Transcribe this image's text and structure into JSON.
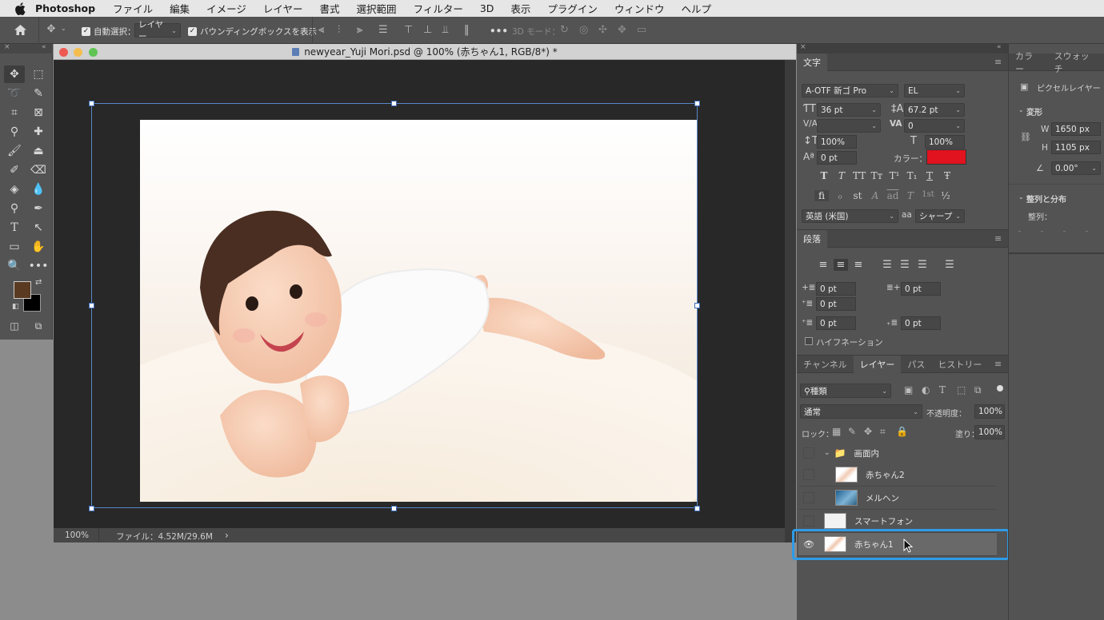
{
  "menubar": {
    "app_name": "Photoshop",
    "items": [
      "ファイル",
      "編集",
      "イメージ",
      "レイヤー",
      "書式",
      "選択範囲",
      "フィルター",
      "3D",
      "表示",
      "プラグイン",
      "ウィンドウ",
      "ヘルプ"
    ]
  },
  "options_bar": {
    "auto_select_label": "自動選択：",
    "auto_select_target": "レイヤー",
    "bounding_box_label": "バウンディングボックスを表示",
    "mode_3d_label": "3D モード：",
    "more": "•••"
  },
  "document": {
    "title": "newyear_Yuji Mori.psd @ 100% (赤ちゃん1, RGB/8*) *",
    "zoom": "100%",
    "file_info": "ファイル：4.52M/29.6M",
    "status_arrow": "›"
  },
  "character_panel": {
    "tab": "文字",
    "font_family": "A-OTF 新ゴ Pro",
    "font_style": "EL",
    "font_size": "36 pt",
    "leading": "67.2 pt",
    "kerning": "",
    "tracking": "0",
    "vertical_scale": "100%",
    "horizontal_scale": "100%",
    "baseline_shift": "0 pt",
    "color_label": "カラー：",
    "color_value": "#e0131f",
    "language": "英語 (米国)",
    "antialias_label": "aa",
    "antialias": "シャープ",
    "style_buttons": [
      "T",
      "T",
      "TT",
      "Tт",
      "T¹",
      "T₁",
      "T",
      "Ŧ"
    ],
    "opentype_buttons": [
      "ﬁ",
      "ℴ",
      "st",
      "A",
      "ad",
      "T",
      "1st",
      "½"
    ]
  },
  "paragraph_panel": {
    "tab": "段落",
    "indent_left": "0 pt",
    "indent_right": "0 pt",
    "indent_first": "0 pt",
    "space_before": "0 pt",
    "space_after": "0 pt",
    "hyphenation_label": "ハイフネーション"
  },
  "properties_panel": {
    "tabs": [
      "カラー",
      "スウォッチ"
    ],
    "layer_type": "ピクセルレイヤー",
    "transform_label": "変形",
    "w_label": "W",
    "w_value": "1650 px",
    "h_label": "H",
    "h_value": "1105 px",
    "angle_value": "0.00°",
    "align_label": "整列と分布",
    "align_sub": "整列："
  },
  "layers_panel": {
    "tabs": [
      "チャンネル",
      "レイヤー",
      "パス",
      "ヒストリー"
    ],
    "active_tab": "レイヤー",
    "filter_label": "種類",
    "blend_mode": "通常",
    "opacity_label": "不透明度：",
    "opacity": "100%",
    "lock_label": "ロック：",
    "fill_label": "塗り：",
    "fill": "100%",
    "layers": [
      {
        "name": "画面内",
        "type": "group",
        "visible": false
      },
      {
        "name": "赤ちゃん2",
        "type": "pixel",
        "visible": false
      },
      {
        "name": "メルヘン",
        "type": "pixel",
        "visible": false
      },
      {
        "name": "スマートフォン",
        "type": "pixel",
        "visible": false
      },
      {
        "name": "赤ちゃん1",
        "type": "pixel",
        "visible": true,
        "selected": true
      }
    ],
    "highlight_color": "#2e9be6"
  },
  "colors": {
    "foreground": "#5a3a20",
    "background": "#000000",
    "selection_accent": "#2e9be6"
  }
}
